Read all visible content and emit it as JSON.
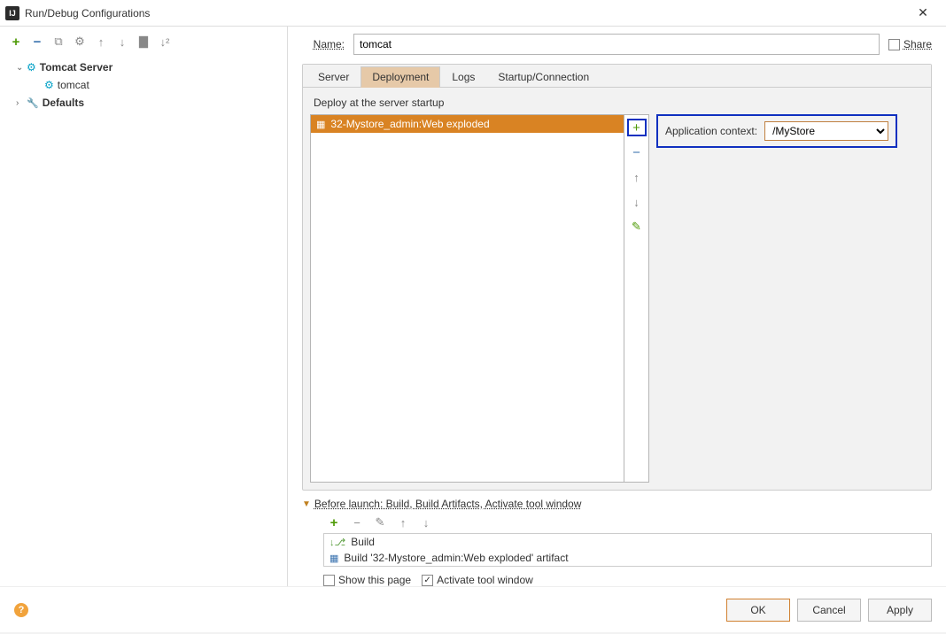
{
  "window": {
    "title": "Run/Debug Configurations"
  },
  "tree": {
    "root": "Tomcat Server",
    "child": "tomcat",
    "defaults": "Defaults"
  },
  "name": {
    "label": "Name:",
    "value": "tomcat"
  },
  "share": {
    "label": "Share"
  },
  "tabs": {
    "server": "Server",
    "deployment": "Deployment",
    "logs": "Logs",
    "startup": "Startup/Connection"
  },
  "deploy": {
    "section_label": "Deploy at the server startup",
    "items": [
      "32-Mystore_admin:Web exploded"
    ],
    "context_label": "Application context:",
    "context_value": "/MyStore"
  },
  "before_launch": {
    "header": "Before launch: Build, Build Artifacts, Activate tool window",
    "rows": [
      "Build",
      "Build '32-Mystore_admin:Web exploded' artifact"
    ]
  },
  "checks": {
    "show_page": "Show this page",
    "activate": "Activate tool window"
  },
  "buttons": {
    "ok": "OK",
    "cancel": "Cancel",
    "apply": "Apply"
  }
}
